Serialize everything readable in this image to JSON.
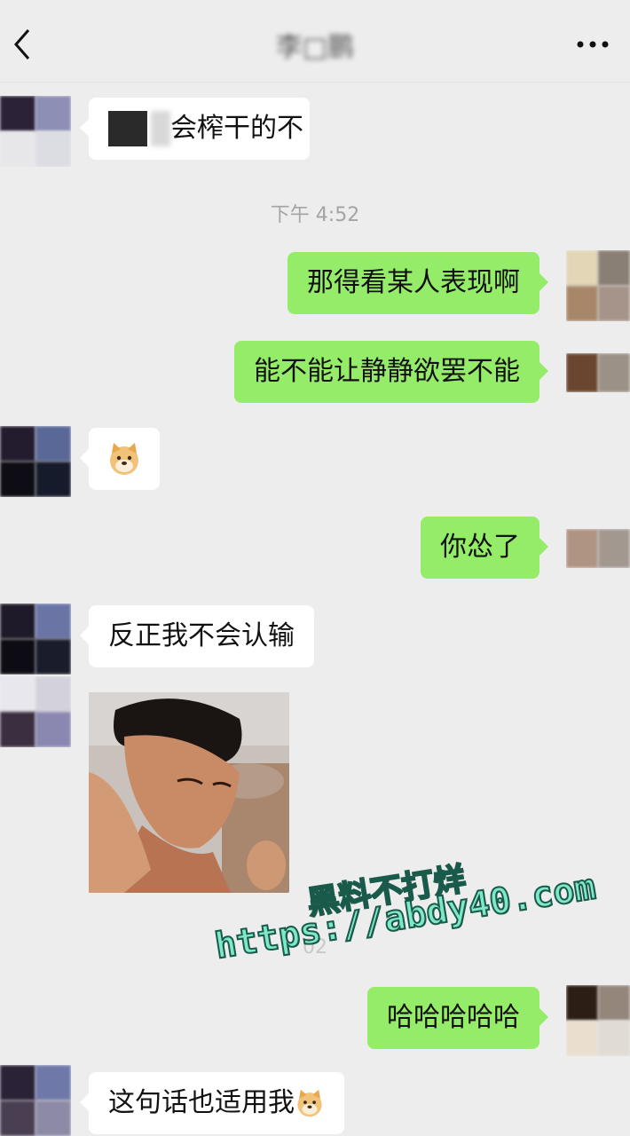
{
  "header": {
    "title": "李□鹏",
    "back_icon": "chevron-left-icon",
    "more_icon": "ellipsis-icon"
  },
  "messages": [
    {
      "side": "in",
      "text": "会榨干的不",
      "partially_obscured": true
    },
    {
      "type": "time",
      "text": "下午 4:52"
    },
    {
      "side": "out",
      "text": "那得看某人表现啊"
    },
    {
      "side": "out",
      "text": "能不能让静静欲罢不能"
    },
    {
      "side": "in",
      "text": "",
      "emoji": "doge-icon"
    },
    {
      "side": "out",
      "text": "你怂了"
    },
    {
      "side": "in",
      "text": "反正我不会认输"
    },
    {
      "side": "in",
      "type": "image",
      "image_description": "young man with clenched fists"
    },
    {
      "side": "out",
      "text": "哈哈哈哈哈"
    },
    {
      "side": "in",
      "text": "这句话也适用我",
      "emoji": "doge-icon"
    }
  ],
  "watermark": {
    "line1": "黑料不打烊",
    "line2": "https://abdy40.com"
  },
  "colors": {
    "background": "#ededed",
    "incoming_bubble": "#ffffff",
    "outgoing_bubble": "#95ec69",
    "watermark_fill": "#7fe8c8"
  }
}
